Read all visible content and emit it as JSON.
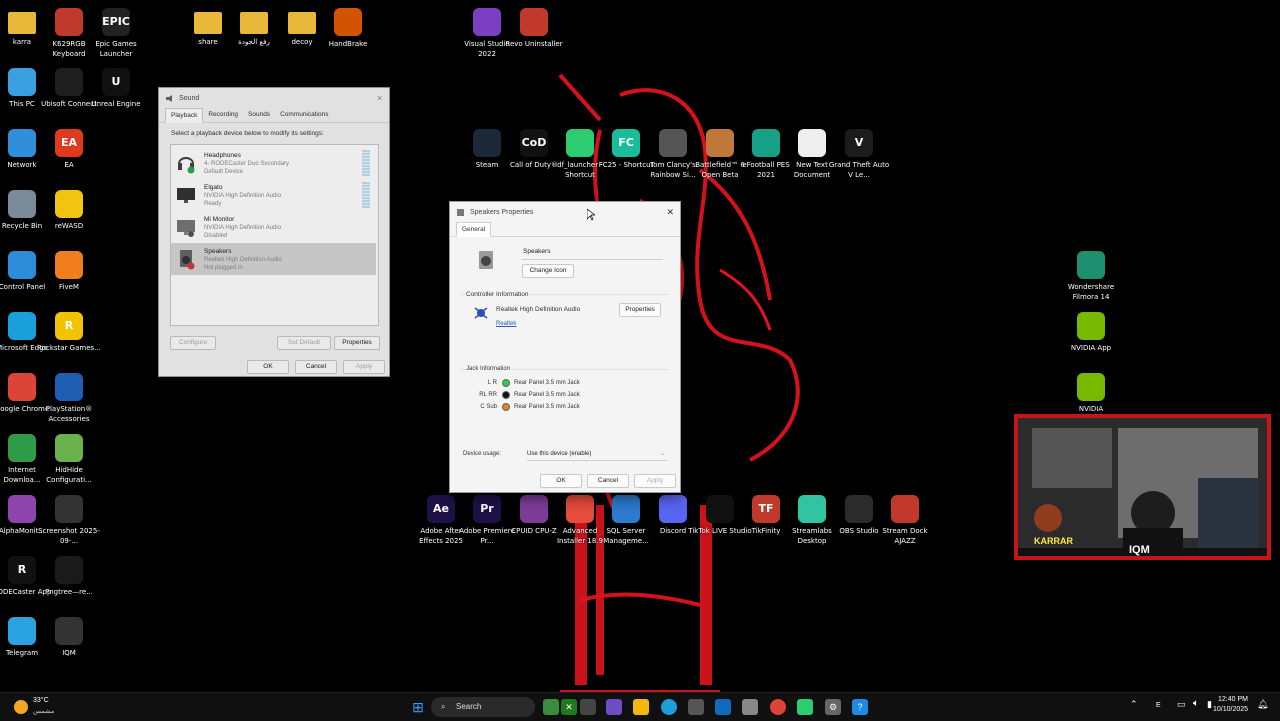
{
  "desktop_icons": [
    {
      "label": "karra",
      "icon": "folder-icon",
      "color": "#e8b83a"
    },
    {
      "label": "K629RGB Keyboard",
      "icon": "keyboard-app-icon",
      "color": "#c0392b"
    },
    {
      "label": "Epic Games Launcher",
      "icon": "epic-games-icon",
      "color": "#222222",
      "glyph": "EPIC"
    },
    {
      "label": "share",
      "icon": "folder-icon",
      "color": "#e8b83a"
    },
    {
      "label": "رفع الجودة",
      "icon": "folder-icon",
      "color": "#e8b83a"
    },
    {
      "label": "decoy",
      "icon": "folder-icon",
      "color": "#e8b83a"
    },
    {
      "label": "HandBrake",
      "icon": "handbrake-icon",
      "color": "#d35400"
    },
    {
      "label": "Visual Studio 2022",
      "icon": "visual-studio-icon",
      "color": "#7b3fc4"
    },
    {
      "label": "Revo Uninstaller",
      "icon": "revo-uninstaller-icon",
      "color": "#c0392b"
    },
    {
      "label": "This PC",
      "icon": "computer-icon",
      "color": "#3aa0e0"
    },
    {
      "label": "Ubisoft Connect",
      "icon": "ubisoft-icon",
      "color": "#1e1e1e"
    },
    {
      "label": "Unreal Engine",
      "icon": "unreal-engine-icon",
      "color": "#111111",
      "glyph": "U"
    },
    {
      "label": "Network",
      "icon": "network-icon",
      "color": "#2f8fd8"
    },
    {
      "label": "EA",
      "icon": "ea-icon",
      "color": "#e03a1e",
      "glyph": "EA"
    },
    {
      "label": "Recycle Bin",
      "icon": "recycle-bin-icon",
      "color": "#7a8a99"
    },
    {
      "label": "reWASD",
      "icon": "rewasd-icon",
      "color": "#f1c40f"
    },
    {
      "label": "Control Panel",
      "icon": "control-panel-icon",
      "color": "#2d8bd7"
    },
    {
      "label": "FiveM",
      "icon": "fivem-icon",
      "color": "#f07d1e"
    },
    {
      "label": "Microsoft Edge",
      "icon": "edge-icon",
      "color": "#1aa0d8"
    },
    {
      "label": "Rockstar Games...",
      "icon": "rockstar-icon",
      "color": "#f2c300",
      "glyph": "R"
    },
    {
      "label": "Google Chrome",
      "icon": "chrome-icon",
      "color": "#db4437"
    },
    {
      "label": "PlayStation® Accessories",
      "icon": "playstation-icon",
      "color": "#1e5fb4"
    },
    {
      "label": "Internet Downloa...",
      "icon": "idm-icon",
      "color": "#2e9b48"
    },
    {
      "label": "HidHide Configurati...",
      "icon": "hidhide-icon",
      "color": "#6ab04c"
    },
    {
      "label": "AlphaMonit...",
      "icon": "alphamonitor-icon",
      "color": "#8e44ad"
    },
    {
      "label": "Screenshot 2025-09-...",
      "icon": "image-file-icon",
      "color": "#333333"
    },
    {
      "label": "RODECaster App",
      "icon": "rodecaster-icon",
      "color": "#111111",
      "glyph": "R"
    },
    {
      "label": "Pngtree—re...",
      "icon": "image-file-icon",
      "color": "#1a1a1a"
    },
    {
      "label": "Telegram",
      "icon": "telegram-icon",
      "color": "#2aa3e0"
    },
    {
      "label": "IQM",
      "icon": "iqm-logo-icon",
      "color": "#333333"
    },
    {
      "label": "Steam",
      "icon": "steam-icon",
      "color": "#1b2838"
    },
    {
      "label": "Call of Duty®",
      "icon": "call-of-duty-icon",
      "color": "#111111",
      "glyph": "CoD"
    },
    {
      "label": "df_launcher - Shortcut",
      "icon": "df-launcher-icon",
      "color": "#2ecc71"
    },
    {
      "label": "FC25 - Shortcut",
      "icon": "fc25-icon",
      "color": "#1abc9c",
      "glyph": "FC"
    },
    {
      "label": "Tom Clancy's Rainbow Si...",
      "icon": "rainbow-six-icon",
      "color": "#555555"
    },
    {
      "label": "Battlefield™ 6 Open Beta",
      "icon": "battlefield-icon",
      "color": "#c0783a"
    },
    {
      "label": "eFootball PES 2021",
      "icon": "efootball-icon",
      "color": "#16a085"
    },
    {
      "label": "New Text Document",
      "icon": "text-document-icon",
      "color": "#eeeeee"
    },
    {
      "label": "Grand Theft Auto V Le...",
      "icon": "gta-v-icon",
      "color": "#1c1c1c",
      "glyph": "V"
    },
    {
      "label": "Wondershare Filmora 14",
      "icon": "filmora-icon",
      "color": "#1e8f6e"
    },
    {
      "label": "NVIDIA App",
      "icon": "nvidia-icon",
      "color": "#76b900"
    },
    {
      "label": "NVIDIA",
      "icon": "nvidia-icon",
      "color": "#76b900"
    },
    {
      "label": "Adobe After Effects 2025",
      "icon": "after-effects-icon",
      "color": "#1f1147",
      "glyph": "Ae"
    },
    {
      "label": "Adobe Premiere Pr...",
      "icon": "premiere-pro-icon",
      "color": "#1f1147",
      "glyph": "Pr"
    },
    {
      "label": "CPUID CPU-Z",
      "icon": "cpu-z-icon",
      "color": "#7d3c98"
    },
    {
      "label": "Advanced Installer 18.9",
      "icon": "advanced-installer-icon",
      "color": "#e74c3c"
    },
    {
      "label": "SQL Server Manageme...",
      "icon": "sql-server-icon",
      "color": "#2c7bd0"
    },
    {
      "label": "Discord",
      "icon": "discord-icon",
      "color": "#5865f2"
    },
    {
      "label": "TikTok LIVE Studio",
      "icon": "tiktok-icon",
      "color": "#111111"
    },
    {
      "label": "TikFinity",
      "icon": "tikfinity-icon",
      "color": "#c0392b",
      "glyph": "TF"
    },
    {
      "label": "Streamlabs Desktop",
      "icon": "streamlabs-icon",
      "color": "#31c3a2"
    },
    {
      "label": "OBS Studio",
      "icon": "obs-icon",
      "color": "#2b2b2b"
    },
    {
      "label": "Stream Dock AJAZZ",
      "icon": "stream-dock-icon",
      "color": "#c0392b"
    }
  ],
  "sound_window": {
    "title": "Sound",
    "tabs": [
      "Playback",
      "Recording",
      "Sounds",
      "Communications"
    ],
    "instruction": "Select a playback device below to modify its settings:",
    "devices": [
      {
        "name": "Headphones",
        "line1": "4- RODECaster Duo Secondary",
        "line2": "Default Device",
        "icon": "headphones-icon"
      },
      {
        "name": "Elgato",
        "line1": "NVIDIA High Definition Audio",
        "line2": "Ready",
        "icon": "monitor-icon"
      },
      {
        "name": "Mi Monitor",
        "line1": "NVIDIA High Definition Audio",
        "line2": "Disabled",
        "icon": "monitor-icon"
      },
      {
        "name": "Speakers",
        "line1": "Realtek High Definition Audio",
        "line2": "Not plugged in",
        "icon": "speaker-icon"
      }
    ],
    "configure": "Configure",
    "set_default": "Set Default",
    "properties": "Properties",
    "ok": "OK",
    "cancel": "Cancel",
    "apply": "Apply"
  },
  "speakers_window": {
    "title": "Speakers Properties",
    "tab": "General",
    "device_name": "Speakers",
    "change_icon": "Change Icon",
    "controller_heading": "Controller Information",
    "controller_name": "Realtek High Definition Audio",
    "controller_link": "Realtek",
    "properties": "Properties",
    "jack_heading": "Jack Information",
    "jacks": [
      {
        "channel": "L R",
        "desc": "Rear Panel 3.5 mm Jack",
        "color": "#2ecc40"
      },
      {
        "channel": "RL RR",
        "desc": "Rear Panel 3.5 mm Jack",
        "color": "#111111"
      },
      {
        "channel": "C Sub",
        "desc": "Rear Panel 3.5 mm Jack",
        "color": "#e67e22"
      }
    ],
    "device_usage_label": "Device usage:",
    "device_usage_value": "Use this device (enable)",
    "ok": "OK",
    "cancel": "Cancel",
    "apply": "Apply"
  },
  "webcam": {
    "left_name": "KARRAR",
    "right_name": "IQM"
  },
  "taskbar": {
    "weather_temp": "33°C",
    "weather_desc": "مشمس",
    "search_placeholder": "Search",
    "lang": "E",
    "time": "12:40 PM",
    "date": "10/10/2025"
  }
}
